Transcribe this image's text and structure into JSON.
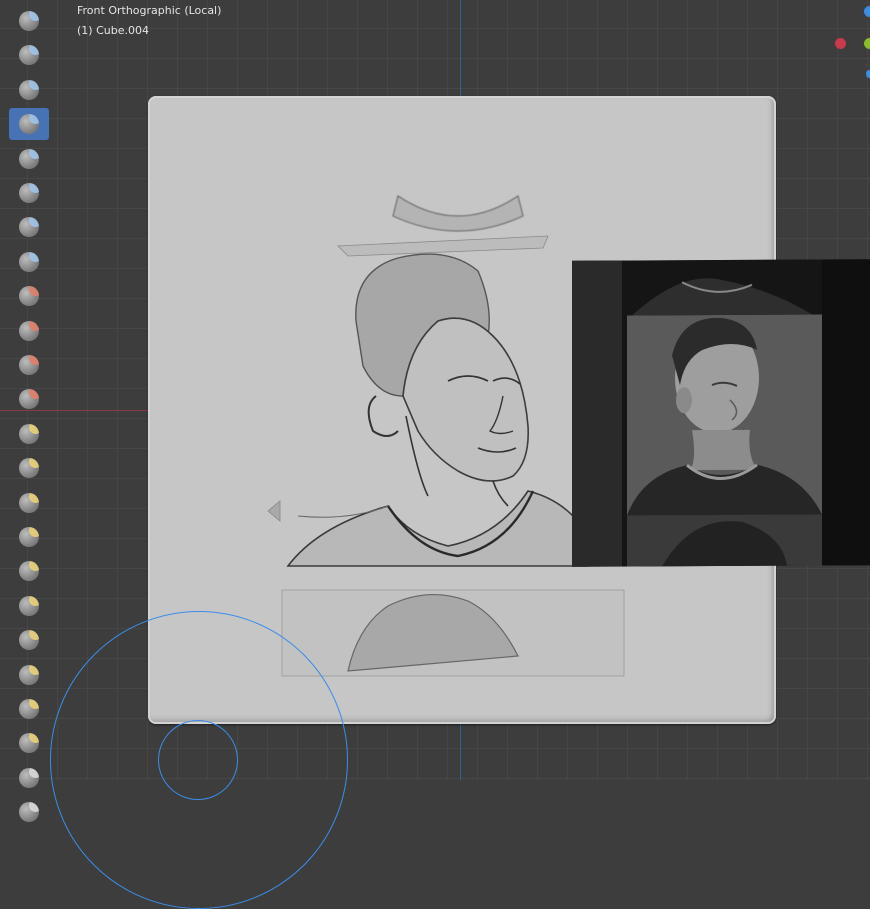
{
  "viewport": {
    "view_name": "Front Orthographic (Local)",
    "object_name": "(1) Cube.004"
  },
  "toolbar": {
    "tools": [
      {
        "name": "draw-brush-icon",
        "color": "#9ec3e8"
      },
      {
        "name": "draw-sharp-brush-icon",
        "color": "#9ec3e8"
      },
      {
        "name": "clay-brush-icon",
        "color": "#9ec3e8"
      },
      {
        "name": "clay-strips-brush-icon",
        "color": "#9ec3e8",
        "active": true
      },
      {
        "name": "clay-thumb-brush-icon",
        "color": "#9ec3e8"
      },
      {
        "name": "layer-brush-icon",
        "color": "#9ec3e8"
      },
      {
        "name": "inflate-brush-icon",
        "color": "#9ec3e8"
      },
      {
        "name": "blob-brush-icon",
        "color": "#9ec3e8"
      },
      {
        "name": "crease-brush-icon",
        "color": "#e0806a"
      },
      {
        "name": "smooth-brush-icon",
        "color": "#e0806a"
      },
      {
        "name": "flatten-brush-icon",
        "color": "#e0806a"
      },
      {
        "name": "fill-brush-icon",
        "color": "#e0806a"
      },
      {
        "name": "scrape-brush-icon",
        "color": "#e8d07a"
      },
      {
        "name": "multiplane-scrape-brush-icon",
        "color": "#e8d07a"
      },
      {
        "name": "pinch-brush-icon",
        "color": "#e8d07a"
      },
      {
        "name": "grab-brush-icon",
        "color": "#e8d07a"
      },
      {
        "name": "elastic-deform-brush-icon",
        "color": "#e8d07a"
      },
      {
        "name": "snake-hook-brush-icon",
        "color": "#e8d07a"
      },
      {
        "name": "thumb-brush-icon",
        "color": "#e8d07a"
      },
      {
        "name": "pose-brush-icon",
        "color": "#e8d07a"
      },
      {
        "name": "nudge-brush-icon",
        "color": "#e8d07a"
      },
      {
        "name": "rotate-brush-icon",
        "color": "#e8d07a"
      },
      {
        "name": "slide-relax-brush-icon",
        "color": "#d8d8d8"
      },
      {
        "name": "boundary-brush-icon",
        "color": "#d8d8d8"
      }
    ]
  },
  "gizmo": {
    "colors": {
      "x": "#c93a4c",
      "y": "#8bbd2a",
      "z": "#3a8ee6"
    }
  }
}
